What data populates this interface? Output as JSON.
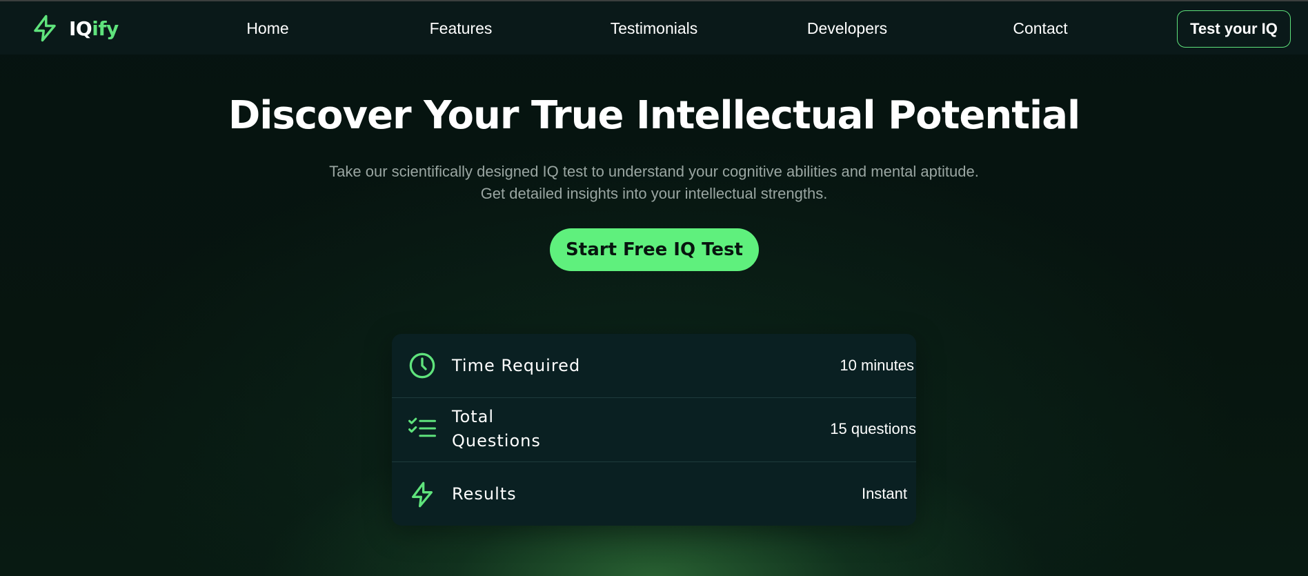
{
  "brand": {
    "name_prefix": "IQ",
    "name_suffix": "ify",
    "logo_icon": "lightning-bolt-icon",
    "accent_color": "#5fe37c"
  },
  "nav": {
    "links": [
      {
        "label": "Home"
      },
      {
        "label": "Features"
      },
      {
        "label": "Testimonials"
      },
      {
        "label": "Developers"
      },
      {
        "label": "Contact"
      }
    ],
    "cta_label": "Test your IQ"
  },
  "hero": {
    "title": "Discover Your True Intellectual Potential",
    "subtitle_line1": "Take our scientifically designed IQ test to understand your cognitive abilities and mental aptitude.",
    "subtitle_line2": "Get detailed insights into your intellectual strengths.",
    "cta_label": "Start Free IQ Test"
  },
  "info": {
    "rows": [
      {
        "icon": "clock-icon",
        "label": "Time Required",
        "value": "10 minutes"
      },
      {
        "icon": "checklist-icon",
        "label_line1": "Total",
        "label_line2": "Questions",
        "value": "15 questions"
      },
      {
        "icon": "lightning-bolt-icon",
        "label": "Results",
        "value": "Instant"
      }
    ]
  }
}
